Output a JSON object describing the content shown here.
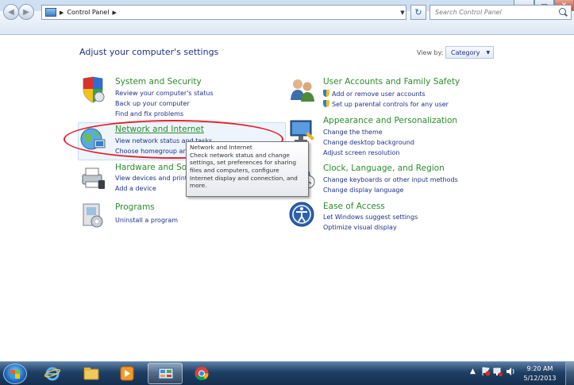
{
  "window": {
    "minimize": "–",
    "maximize": "▭",
    "close": "✕"
  },
  "nav": {
    "back": "◀",
    "forward": "▶",
    "breadcrumb": [
      "Control Panel"
    ],
    "separator": "▶",
    "dropdown": "▼",
    "refresh": "↻",
    "search_placeholder": "Search Control Panel"
  },
  "main": {
    "heading": "Adjust your computer's settings",
    "view_by_label": "View by:",
    "view_by_value": "Category",
    "view_by_arrow": "▼"
  },
  "categories_left": [
    {
      "title": "System and Security",
      "icon": "shield-icon",
      "links": [
        "Review your computer's status",
        "Back up your computer",
        "Find and fix problems"
      ]
    },
    {
      "title": "Network and Internet",
      "icon": "network-globe-icon",
      "links": [
        "View network status and tasks",
        "Choose homegroup and sharing options"
      ]
    },
    {
      "title": "Hardware and Sound",
      "icon": "printer-icon",
      "links": [
        "View devices and printers",
        "Add a device"
      ]
    },
    {
      "title": "Programs",
      "icon": "programs-icon",
      "links": [
        "Uninstall a program"
      ]
    }
  ],
  "categories_right": [
    {
      "title": "User Accounts and Family Safety",
      "icon": "users-icon",
      "links": [
        "Add or remove user accounts",
        "Set up parental controls for any user"
      ]
    },
    {
      "title": "Appearance and Personalization",
      "icon": "monitor-icon",
      "links": [
        "Change the theme",
        "Change desktop background",
        "Adjust screen resolution"
      ]
    },
    {
      "title": "Clock, Language, and Region",
      "icon": "globe-clock-icon",
      "links": [
        "Change keyboards or other input methods",
        "Change display language"
      ]
    },
    {
      "title": "Ease of Access",
      "icon": "ease-of-access-icon",
      "links": [
        "Let Windows suggest settings",
        "Optimize visual display"
      ]
    }
  ],
  "tooltip": {
    "lines": [
      "Network and Internet",
      "Check network status and change",
      "settings, set preferences for sharing",
      "files and computers, configure",
      "Internet display and connection, and",
      "more."
    ]
  },
  "taskbar": {
    "items": [
      "start-orb-icon",
      "internet-explorer-icon",
      "folder-icon",
      "media-player-icon",
      "control-panel-icon",
      "chrome-icon"
    ],
    "tray_arrow": "▲",
    "time": "9:20 AM",
    "date": "5/12/2013"
  }
}
